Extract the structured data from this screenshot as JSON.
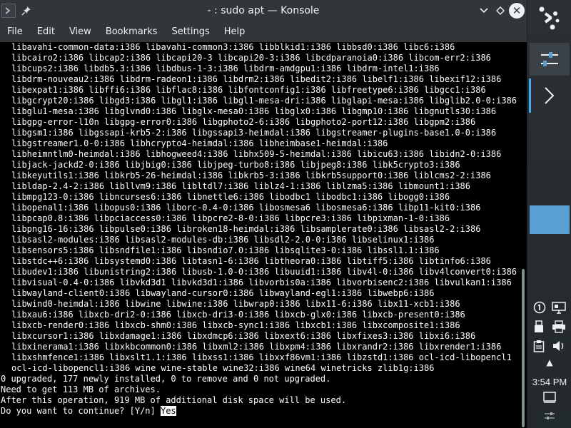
{
  "window": {
    "title": "- : sudo apt — Konsole",
    "close_glyph": "✕",
    "min_glyph": "⌄",
    "keep_above_glyph": "◇",
    "menu": [
      "File",
      "Edit",
      "View",
      "Bookmarks",
      "Settings",
      "Help"
    ]
  },
  "terminal": {
    "lines": [
      "libavahi-common-data:i386 libavahi-common3:i386 libblkid1:i386 libbsd0:i386 libc6:i386",
      "libcairo2:i386 libcap2:i386 libcapi20-3 libcapi20-3:i386 libcdparanoia0:i386 libcom-err2:i386",
      "libcups2:i386 libdb5.3:i386 libdbus-1-3:i386 libdrm-amdgpu1:i386 libdrm-intel1:i386",
      "libdrm-nouveau2:i386 libdrm-radeon1:i386 libdrm2:i386 libedit2:i386 libelf1:i386 libexif12:i386",
      "libexpat1:i386 libffi6:i386 libflac8:i386 libfontconfig1:i386 libfreetype6:i386 libgcc1:i386",
      "libgcrypt20:i386 libgd3:i386 libgl1:i386 libgl1-mesa-dri:i386 libglapi-mesa:i386 libglib2.0-0:i386",
      "libglu1-mesa:i386 libglvnd0:i386 libglx-mesa0:i386 libglx0:i386 libgmp10:i386 libgnutls30:i386",
      "libgpg-error-l10n libgpg-error0:i386 libgphoto2-6:i386 libgphoto2-port12:i386 libgpm2:i386",
      "libgsm1:i386 libgssapi-krb5-2:i386 libgssapi3-heimdal:i386 libgstreamer-plugins-base1.0-0:i386",
      "libgstreamer1.0-0:i386 libhcrypto4-heimdal:i386 libheimbase1-heimdal:i386",
      "libheimntlm0-heimdal:i386 libhogweed4:i386 libhx509-5-heimdal:i386 libicu63:i386 libidn2-0:i386",
      "libjack-jackd2-0:i386 libjbig0:i386 libjpeg-turbo8:i386 libjpeg8:i386 libk5crypto3:i386",
      "libkeyutils1:i386 libkrb5-26-heimdal:i386 libkrb5-3:i386 libkrb5support0:i386 liblcms2-2:i386",
      "libldap-2.4-2:i386 libllvm9:i386 libltdl7:i386 liblz4-1:i386 liblzma5:i386 libmount1:i386",
      "libmpg123-0:i386 libncurses6:i386 libnettle6:i386 libodbc1 libodbc1:i386 libogg0:i386",
      "libopenal1:i386 libopus0:i386 liborc-0.4-0:i386 libosmesa6 libosmesa6:i386 libp11-kit0:i386",
      "libpcap0.8:i386 libpciaccess0:i386 libpcre2-8-0:i386 libpcre3:i386 libpixman-1-0:i386",
      "libpng16-16:i386 libpulse0:i386 libroken18-heimdal:i386 libsamplerate0:i386 libsasl2-2:i386",
      "libsasl2-modules:i386 libsasl2-modules-db:i386 libsdl2-2.0-0:i386 libselinux1:i386",
      "libsensors5:i386 libsndfile1:i386 libsndio7.0:i386 libsqlite3-0:i386 libssl1.1:i386",
      "libstdc++6:i386 libsystemd0:i386 libtasn1-6:i386 libtheora0:i386 libtiff5:i386 libtinfo6:i386",
      "libudev1:i386 libunistring2:i386 libusb-1.0-0:i386 libuuid1:i386 libv4l-0:i386 libv4lconvert0:i386",
      "libvisual-0.4-0:i386 libvkd3d1 libvkd3d1:i386 libvorbis0a:i386 libvorbisenc2:i386 libvulkan1:i386",
      "libwayland-client0:i386 libwayland-cursor0:i386 libwayland-egl1:i386 libwebp6:i386",
      "libwind0-heimdal:i386 libwine libwine:i386 libwrap0:i386 libx11-6:i386 libx11-xcb1:i386",
      "libxau6:i386 libxcb-dri2-0:i386 libxcb-dri3-0:i386 libxcb-glx0:i386 libxcb-present0:i386",
      "libxcb-render0:i386 libxcb-shm0:i386 libxcb-sync1:i386 libxcb1:i386 libxcomposite1:i386",
      "libxcursor1:i386 libxdamage1:i386 libxdmcp6:i386 libxext6:i386 libxfixes3:i386 libxi6:i386",
      "libxinerama1:i386 libxkbcommon0:i386 libxml2:i386 libxpm4:i386 libxrandr2:i386 libxrender1:i386",
      "libxshmfence1:i386 libxslt1.1:i386 libxss1:i386 libxxf86vm1:i386 libzstd1:i386 ocl-icd-libopencl1",
      "ocl-icd-libopencl1:i386 wine wine-stable wine32:i386 wine64 winetricks zlib1g:i386"
    ],
    "summary": [
      "0 upgraded, 177 newly installed, 0 to remove and 0 not upgraded.",
      "Need to get 113 MB of archives.",
      "After this operation, 919 MB of additional disk space will be used."
    ],
    "prompt": "Do you want to continue? [Y/n] ",
    "input": "Yes"
  },
  "panel": {
    "clock": "3:54 PM",
    "task_arrow_glyph": "›",
    "tray_expand_glyph": "▲"
  },
  "colors": {
    "titlebar_bg": "#31363b",
    "terminal_bg": "#000000",
    "terminal_fg": "#fcfcfc",
    "panel_bg": "#272c30",
    "accent_blue": "#5a9fd4",
    "active_indicator": "#3daee9"
  }
}
